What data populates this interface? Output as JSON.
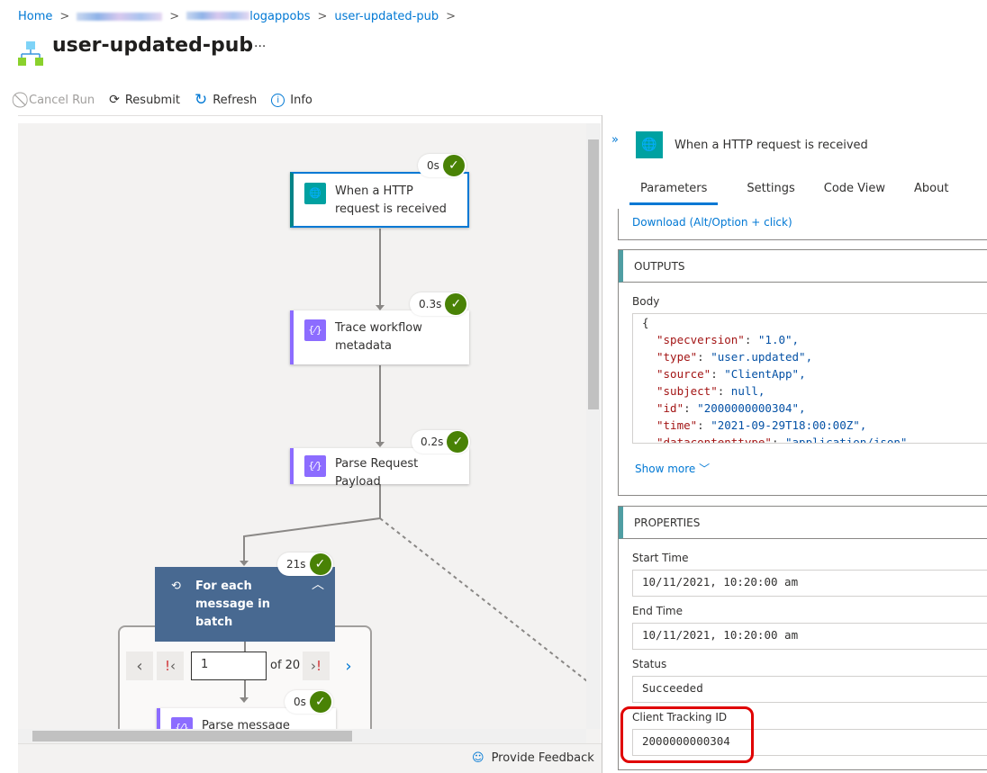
{
  "breadcrumb": {
    "home": "Home",
    "item3": "logappobs",
    "item4": "user-updated-pub"
  },
  "page": {
    "title": "user-updated-pub",
    "more": "···"
  },
  "toolbar": {
    "cancel": "Cancel Run",
    "resubmit": "Resubmit",
    "refresh": "Refresh",
    "info": "Info"
  },
  "workflow": {
    "trigger": {
      "label": "When a HTTP request is received",
      "duration": "0s"
    },
    "trace": {
      "label": "Trace workflow metadata",
      "duration": "0.3s"
    },
    "parse": {
      "label": "Parse Request Payload",
      "duration": "0.2s"
    },
    "foreach": {
      "label": "For each message in batch",
      "duration": "21s"
    },
    "pager": {
      "value": "1",
      "of": "of 20"
    },
    "parse_message": {
      "label": "Parse message",
      "duration": "0s"
    }
  },
  "feedback": "Provide Feedback",
  "panel": {
    "title": "When a HTTP request is received",
    "tabs": [
      "Parameters",
      "Settings",
      "Code View",
      "About"
    ],
    "download": "Download (Alt/Option + click)",
    "outputs": {
      "header": "OUTPUTS",
      "body_label": "Body",
      "show_more": "Show more",
      "lines": [
        {
          "k": "\"specversion\"",
          "v": "\"1.0\","
        },
        {
          "k": "\"type\"",
          "v": "\"user.updated\","
        },
        {
          "k": "\"source\"",
          "v": "\"ClientApp\","
        },
        {
          "k": "\"subject\"",
          "v": "null,"
        },
        {
          "k": "\"id\"",
          "v": "\"2000000000304\","
        },
        {
          "k": "\"time\"",
          "v": "\"2021-09-29T18:00:00Z\","
        },
        {
          "k": "\"datacontenttype\"",
          "v": "\"application/json\""
        }
      ]
    },
    "properties": {
      "header": "PROPERTIES",
      "start_label": "Start Time",
      "start": "10/11/2021, 10:20:00 am",
      "end_label": "End Time",
      "end": "10/11/2021, 10:20:00 am",
      "status_label": "Status",
      "status": "Succeeded",
      "tracking_label": "Client Tracking ID",
      "tracking": "2000000000304"
    }
  },
  "colors": {
    "accent": "#0078d4",
    "success": "#498205",
    "trigger": "#00a1a1",
    "action": "#8c6cff",
    "foreach": "#486991",
    "highlight": "#e00000"
  }
}
